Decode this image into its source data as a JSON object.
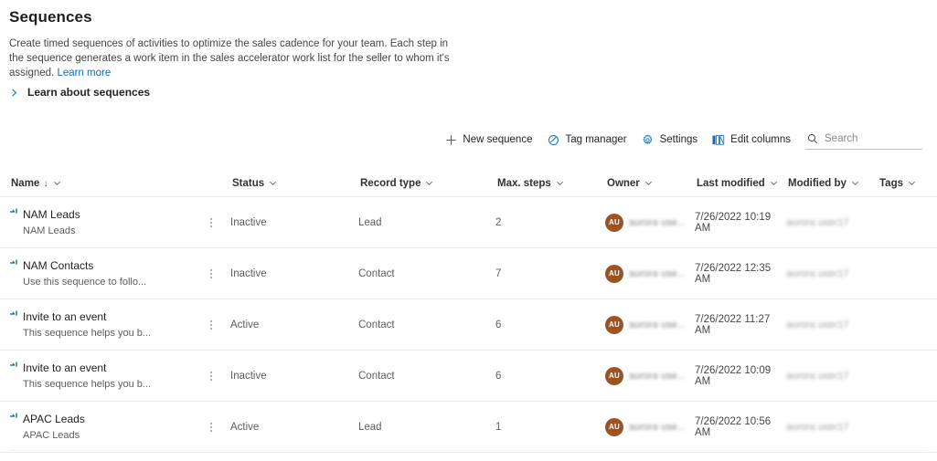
{
  "header": {
    "title": "Sequences",
    "intro_text": "Create timed sequences of activities to optimize the sales cadence for your team. Each step in the sequence generates a work item in the sales accelerator work list for the seller to whom it's assigned. ",
    "intro_link": "Learn more",
    "learn_section_label": "Learn about sequences",
    "chevron_icon": "chevron-right-icon"
  },
  "toolbar": {
    "new_sequence": {
      "label": "New sequence",
      "icon": "plus-icon"
    },
    "tag_manager": {
      "label": "Tag manager",
      "icon": "tag-icon"
    },
    "settings": {
      "label": "Settings",
      "icon": "gear-icon"
    },
    "edit_columns": {
      "label": "Edit columns",
      "icon": "columns-icon"
    },
    "search": {
      "placeholder": "Search",
      "value": "",
      "icon": "search-icon"
    }
  },
  "grid": {
    "columns": [
      {
        "label": "Name",
        "sort": "↓",
        "menu_icon": "chevron-down-icon"
      },
      {
        "label": "Status",
        "menu_icon": "chevron-down-icon"
      },
      {
        "label": "Record type",
        "menu_icon": "chevron-down-icon"
      },
      {
        "label": "Max. steps",
        "menu_icon": "chevron-down-icon"
      },
      {
        "label": "Owner",
        "menu_icon": "chevron-down-icon"
      },
      {
        "label": "Last modified",
        "menu_icon": "chevron-down-icon"
      },
      {
        "label": "Modified by",
        "menu_icon": "chevron-down-icon"
      },
      {
        "label": "Tags",
        "menu_icon": "chevron-down-icon"
      }
    ],
    "rows": [
      {
        "name": "NAM Leads",
        "description": "NAM Leads",
        "status": "Inactive",
        "record_type": "Lead",
        "max_steps": "2",
        "owner_initials": "AU",
        "owner_name": "aurora use...",
        "last_modified": "7/26/2022 10:19 AM",
        "modified_by": "aurora user17",
        "tags": ""
      },
      {
        "name": "NAM Contacts",
        "description": "Use this sequence to follo...",
        "status": "Inactive",
        "record_type": "Contact",
        "max_steps": "7",
        "owner_initials": "AU",
        "owner_name": "aurora use...",
        "last_modified": "7/26/2022 12:35 AM",
        "modified_by": "aurora user17",
        "tags": ""
      },
      {
        "name": "Invite to an event",
        "description": "This sequence helps you b...",
        "status": "Active",
        "record_type": "Contact",
        "max_steps": "6",
        "owner_initials": "AU",
        "owner_name": "aurora use...",
        "last_modified": "7/26/2022 11:27 AM",
        "modified_by": "aurora user17",
        "tags": ""
      },
      {
        "name": "Invite to an event",
        "description": "This sequence helps you b...",
        "status": "Inactive",
        "record_type": "Contact",
        "max_steps": "6",
        "owner_initials": "AU",
        "owner_name": "aurora use...",
        "last_modified": "7/26/2022 10:09 AM",
        "modified_by": "aurora user17",
        "tags": ""
      },
      {
        "name": "APAC Leads",
        "description": "APAC Leads",
        "status": "Active",
        "record_type": "Lead",
        "max_steps": "1",
        "owner_initials": "AU",
        "owner_name": "aurora use...",
        "last_modified": "7/26/2022 10:56 AM",
        "modified_by": "aurora user17",
        "tags": ""
      }
    ],
    "row_icon": "sequence-icon",
    "row_menu_icon": "more-vertical-icon"
  },
  "colors": {
    "accent": "#0f6cbd",
    "avatar": "#9b5324",
    "text_primary": "#201f1e",
    "text_secondary": "#605e5c",
    "divider": "#edebe9"
  }
}
